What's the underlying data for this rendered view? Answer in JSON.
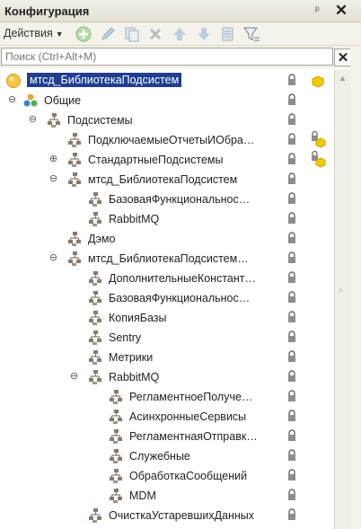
{
  "window": {
    "title": "Конфигурация"
  },
  "toolbar": {
    "actions_label": "Действия"
  },
  "search": {
    "placeholder": "Поиск (Ctrl+Alt+M)"
  },
  "tree": [
    {
      "label": "мтсд_БиблиотекаПодсистем",
      "depth": 0,
      "icon": "config-root-icon",
      "expander": "",
      "lock": true,
      "extra": "cube",
      "selected": true
    },
    {
      "label": "Общие",
      "depth": 0,
      "icon": "common-objects-icon",
      "expander": "minus",
      "lock": true
    },
    {
      "label": "Подсистемы",
      "depth": 1,
      "icon": "subsystem-icon",
      "expander": "minus",
      "lock": true
    },
    {
      "label": "ПодключаемыеОтчетыИОбра…",
      "depth": 2,
      "icon": "subsystem-icon",
      "expander": "",
      "lock": true,
      "extra": "lock-cube"
    },
    {
      "label": "СтандартныеПодсистемы",
      "depth": 2,
      "icon": "subsystem-icon",
      "expander": "plus",
      "lock": true,
      "extra": "lock-cube"
    },
    {
      "label": "мтсд_БиблиотекаПодсистем",
      "depth": 2,
      "icon": "subsystem-icon",
      "expander": "minus",
      "lock": true
    },
    {
      "label": "БазоваяФункциональнос…",
      "depth": 3,
      "icon": "subsystem-icon",
      "expander": "",
      "lock": true
    },
    {
      "label": "RabbitMQ",
      "depth": 3,
      "icon": "subsystem-icon",
      "expander": "",
      "lock": true
    },
    {
      "label": "Дэмо",
      "depth": 2,
      "icon": "subsystem-icon",
      "expander": "",
      "lock": true
    },
    {
      "label": "мтсд_БиблиотекаПодсистем…",
      "depth": 2,
      "icon": "subsystem-icon",
      "expander": "minus",
      "lock": true
    },
    {
      "label": "ДополнительныеКонстант…",
      "depth": 3,
      "icon": "subsystem-icon",
      "expander": "",
      "lock": true
    },
    {
      "label": "БазоваяФункциональнос…",
      "depth": 3,
      "icon": "subsystem-icon",
      "expander": "",
      "lock": true
    },
    {
      "label": "КопияБазы",
      "depth": 3,
      "icon": "subsystem-icon",
      "expander": "",
      "lock": true
    },
    {
      "label": "Sentry",
      "depth": 3,
      "icon": "subsystem-icon",
      "expander": "",
      "lock": true
    },
    {
      "label": "Метрики",
      "depth": 3,
      "icon": "subsystem-icon",
      "expander": "",
      "lock": true
    },
    {
      "label": "RabbitMQ",
      "depth": 3,
      "icon": "subsystem-icon",
      "expander": "minus",
      "lock": true
    },
    {
      "label": "РегламентноеПолуче…",
      "depth": 4,
      "icon": "subsystem-icon",
      "expander": "",
      "lock": true
    },
    {
      "label": "АсинхронныеСервисы",
      "depth": 4,
      "icon": "subsystem-icon",
      "expander": "",
      "lock": true
    },
    {
      "label": "РегламентнаяОтправк…",
      "depth": 4,
      "icon": "subsystem-icon",
      "expander": "",
      "lock": true
    },
    {
      "label": "Служебные",
      "depth": 4,
      "icon": "subsystem-icon",
      "expander": "",
      "lock": true
    },
    {
      "label": "ОбработкаСообщений",
      "depth": 4,
      "icon": "subsystem-icon",
      "expander": "",
      "lock": true
    },
    {
      "label": "MDM",
      "depth": 4,
      "icon": "subsystem-icon",
      "expander": "",
      "lock": true
    },
    {
      "label": "ОчисткаУстаревшихДанных",
      "depth": 3,
      "icon": "subsystem-icon",
      "expander": "",
      "lock": true
    }
  ]
}
